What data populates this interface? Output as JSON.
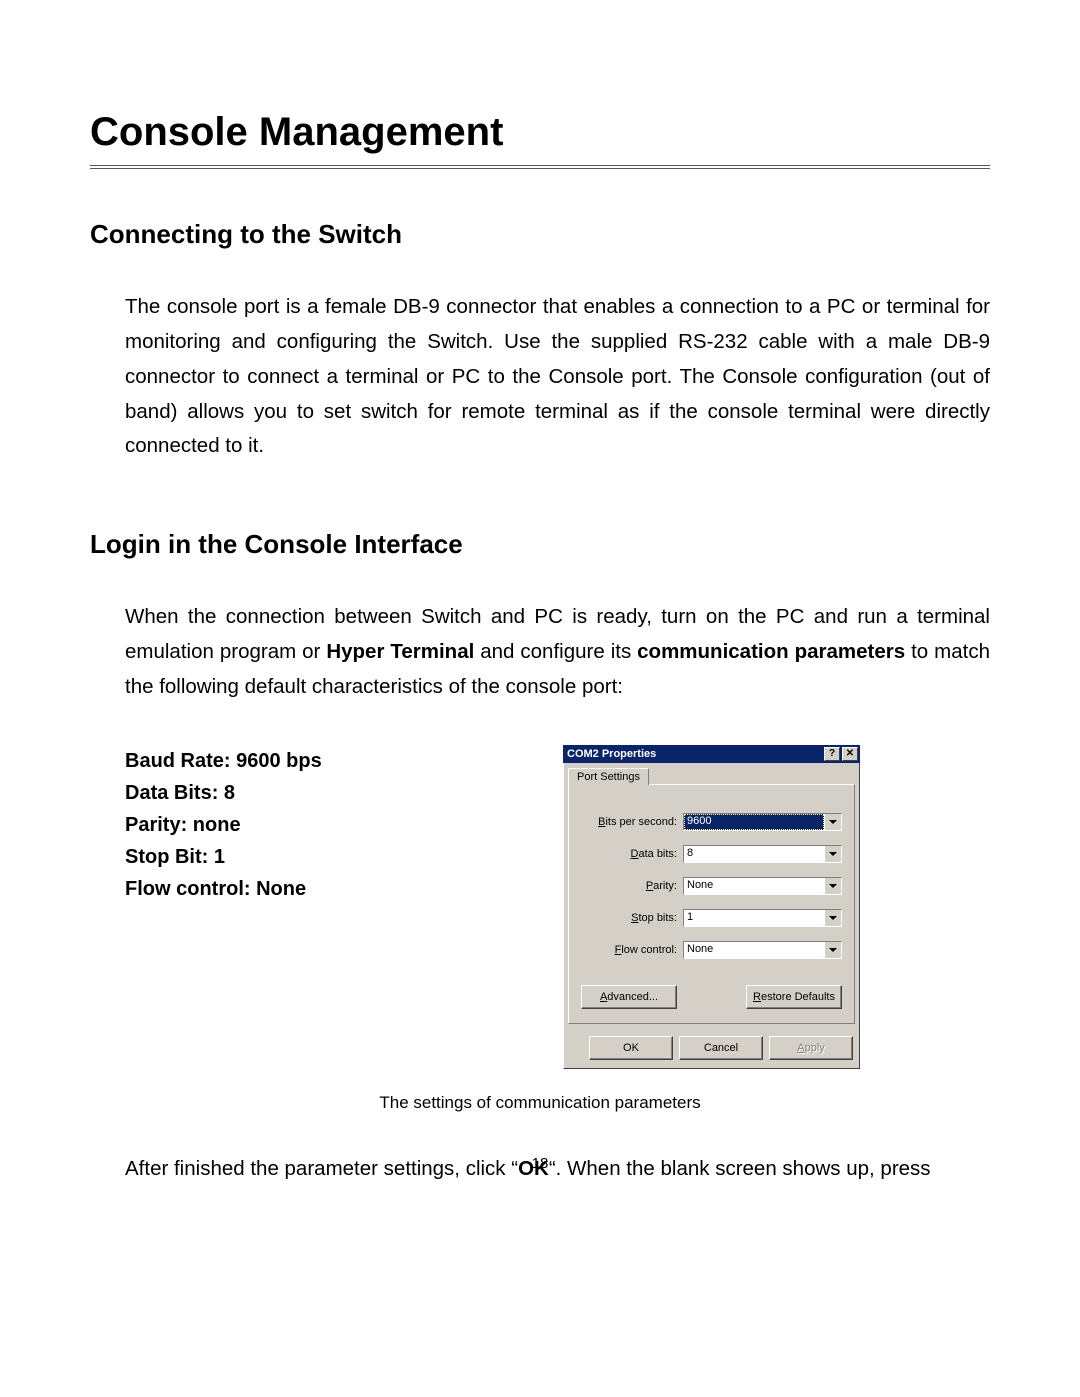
{
  "page": {
    "title": "Console Management",
    "section1": {
      "heading": "Connecting to the Switch",
      "body": "The console port is a female DB-9 connector that enables a connection to a PC or terminal for monitoring and configuring the Switch. Use the supplied RS-232 cable with a male DB-9 connector to connect a terminal or PC to the Console port. The Console configuration (out of band) allows you to set switch for remote terminal as if the console terminal were directly connected to it."
    },
    "section2": {
      "heading": "Login in the Console Interface",
      "body_pre": "When the connection between Switch and PC is ready, turn on the PC and run a terminal emulation program or ",
      "body_bold1": "Hyper Terminal",
      "body_mid": " and configure its ",
      "body_bold2": "communication parameters",
      "body_post": " to match the following default characteristics of the console port:"
    },
    "params": {
      "baud": "Baud Rate: 9600 bps",
      "data_bits": "Data Bits: 8",
      "parity": "Parity: none",
      "stop_bit": "Stop Bit: 1",
      "flow": "Flow control: None"
    },
    "dialog": {
      "title": "COM2 Properties",
      "tab": "Port Settings",
      "fields": {
        "bps": {
          "label_pre": "B",
          "label_post": "its per second:",
          "value": "9600"
        },
        "databits": {
          "label_pre": "D",
          "label_post": "ata bits:",
          "value": "8"
        },
        "parity": {
          "label_pre": "P",
          "label_post": "arity:",
          "value": "None"
        },
        "stopbits": {
          "label_pre": "S",
          "label_post": "top bits:",
          "value": "1"
        },
        "flow": {
          "label_pre": "F",
          "label_post": "low control:",
          "value": "None"
        }
      },
      "buttons": {
        "advanced_pre": "A",
        "advanced_post": "dvanced...",
        "restore_pre": "R",
        "restore_post": "estore Defaults",
        "ok": "OK",
        "cancel": "Cancel",
        "apply_pre": "A",
        "apply_post": "pply"
      }
    },
    "caption": "The settings of communication parameters",
    "after_pre": "After finished the parameter settings, click “",
    "after_bold": "OK",
    "after_post": "“. When the blank screen shows up, press",
    "page_number": "18"
  }
}
